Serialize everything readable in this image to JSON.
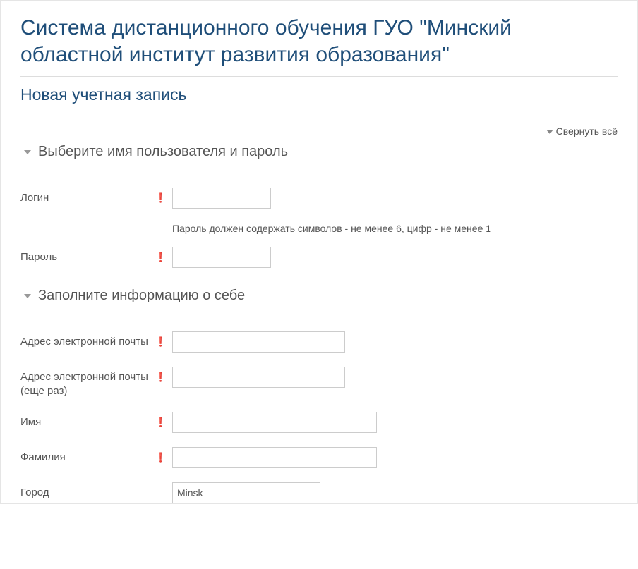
{
  "page": {
    "title": "Система дистанционного обучения ГУО \"Минский областной институт развития образования\"",
    "subtitle": "Новая учетная запись",
    "collapse_all": "Свернуть всё"
  },
  "section1": {
    "legend": "Выберите имя пользователя и пароль",
    "login_label": "Логин",
    "password_label": "Пароль",
    "password_hint": "Пароль должен содержать символов - не менее 6, цифр - не менее 1"
  },
  "section2": {
    "legend": "Заполните информацию о себе",
    "email_label": "Адрес электронной почты",
    "email2_label": "Адрес электронной почты (еще раз)",
    "firstname_label": "Имя",
    "lastname_label": "Фамилия",
    "city_label": "Город",
    "city_value": "Minsk"
  }
}
